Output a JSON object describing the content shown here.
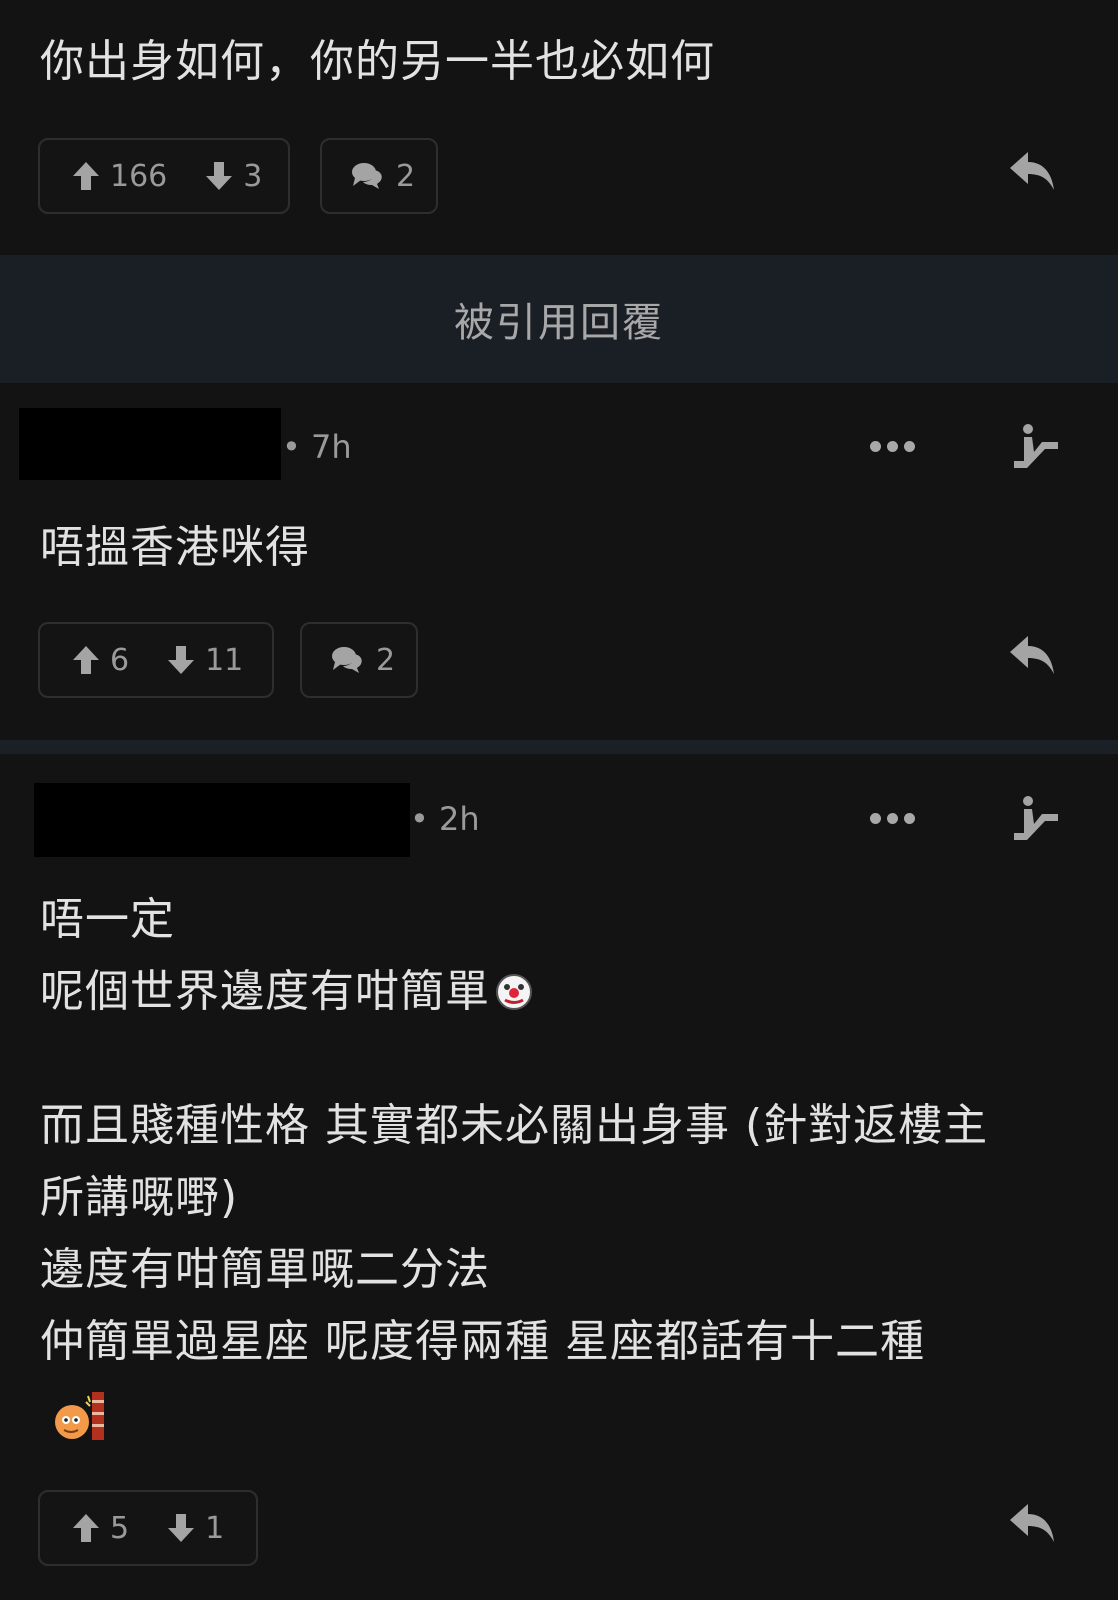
{
  "post": {
    "text": "你出身如何，你的另一半也必如何",
    "upvotes": "166",
    "downvotes": "3",
    "comments": "2"
  },
  "quoted_banner": "被引用回覆",
  "reply1": {
    "time": "• 7h",
    "text": "唔搵香港咪得",
    "upvotes": "6",
    "downvotes": "11",
    "comments": "2"
  },
  "reply2": {
    "time": "• 2h",
    "lines": [
      "唔一定",
      "呢個世界邊度有咁簡單",
      "",
      "而且賤種性格 其實都未必關出身事 (針對返樓主",
      "所講嘅嘢)",
      "邊度有咁簡單嘅二分法",
      "仲簡單過星座 呢度得兩種 星座都話有十二種"
    ],
    "upvotes": "5",
    "downvotes": "1"
  },
  "icons": {
    "upvote": "arrow-up-icon",
    "downvote": "arrow-down-icon",
    "comment": "chat-bubbles-icon",
    "reply": "reply-arrow-icon",
    "more": "ellipsis-icon",
    "quote": "escalator-icon",
    "emoji_clown": "clown-face-emoji-icon",
    "emoji_wall": "wall-banging-emoji-icon"
  },
  "colors": {
    "background": "#131313",
    "banner": "#1a1e25",
    "text": "#e2e2e2",
    "muted": "#9a9a9a"
  }
}
